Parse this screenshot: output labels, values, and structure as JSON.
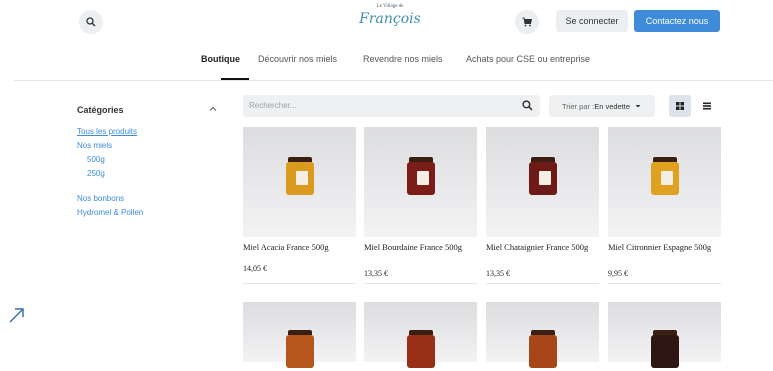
{
  "header": {
    "logo_small": "Le Village de",
    "logo_name": "François",
    "login_label": "Se connecter",
    "contact_label": "Contactez nous"
  },
  "nav": {
    "items": [
      {
        "label": "Boutique",
        "active": true
      },
      {
        "label": "Découvrir nos miels",
        "active": false
      },
      {
        "label": "Revendre nos miels",
        "active": false
      },
      {
        "label": "Achats pour CSE ou entreprise",
        "active": false
      }
    ]
  },
  "sidebar": {
    "title": "Catégories",
    "items": [
      {
        "label": "Tous les produits"
      },
      {
        "label": "Nos miels"
      },
      {
        "label": "500g"
      },
      {
        "label": "250g"
      },
      {
        "label": "Nos bonbons"
      },
      {
        "label": "Hydromel & Pollen"
      }
    ]
  },
  "toolbar": {
    "search_placeholder": "Rechercher...",
    "sort_prefix": "Trier par : ",
    "sort_value": "En vedette"
  },
  "products": [
    {
      "name": "Miel Acacia France 500g",
      "price": "14,05 €",
      "jar_color": "#d99a1e"
    },
    {
      "name": "Miel Bourdaine France 500g",
      "price": "13,35 €",
      "jar_color": "#7a1c17"
    },
    {
      "name": "Miel Chataignier France 500g",
      "price": "13,35 €",
      "jar_color": "#6e1a16"
    },
    {
      "name": "Miel Citronnier Espagne 500g",
      "price": "9,95 €",
      "jar_color": "#e0a020"
    }
  ],
  "products_row2": [
    {
      "jar_color": "#b7561a"
    },
    {
      "jar_color": "#9a2f17"
    },
    {
      "jar_color": "#a8461a"
    },
    {
      "jar_color": "#2e1712"
    }
  ],
  "colors": {
    "accent": "#3d8bd9",
    "link": "#3d8bd9"
  },
  "icons": {
    "search": "search-icon",
    "cart": "cart-icon",
    "chevron": "chevron-up-icon",
    "grid": "grid-view-icon",
    "list": "list-view-icon"
  }
}
